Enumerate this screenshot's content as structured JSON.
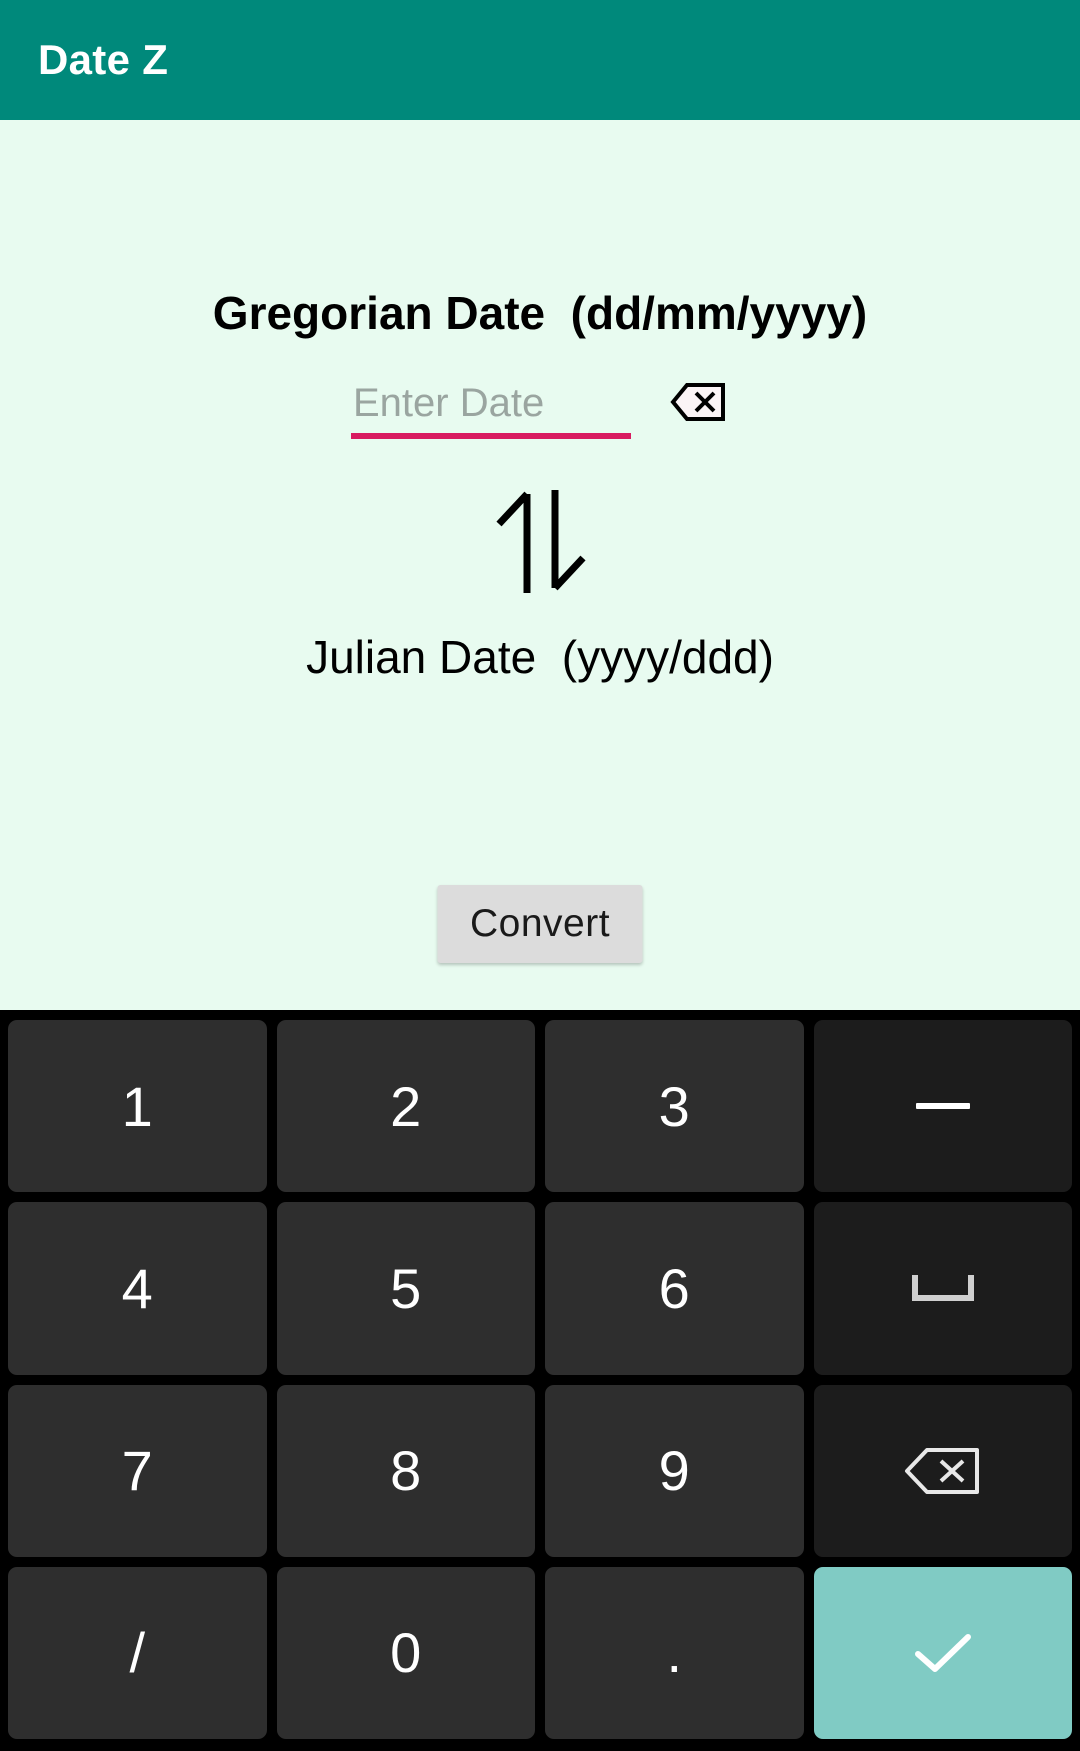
{
  "app": {
    "title": "Date Z",
    "appbar_color": "#00897b",
    "background_color": "#e8fbf0"
  },
  "form": {
    "gregorian_label": "Gregorian Date  (dd/mm/yyyy)",
    "julian_label": "Julian Date  (yyyy/ddd)",
    "date_input_value": "",
    "date_input_placeholder": "Enter Date",
    "underline_color": "#d81b60",
    "clear_icon": "backspace-icon",
    "swap_icon": "up-down-arrows-icon",
    "convert_label": "Convert"
  },
  "keyboard": {
    "rows": [
      [
        {
          "label": "1",
          "name": "key-1",
          "type": "digit"
        },
        {
          "label": "2",
          "name": "key-2",
          "type": "digit"
        },
        {
          "label": "3",
          "name": "key-3",
          "type": "digit"
        },
        {
          "label": "–",
          "name": "key-dash",
          "type": "fn-dash"
        }
      ],
      [
        {
          "label": "4",
          "name": "key-4",
          "type": "digit"
        },
        {
          "label": "5",
          "name": "key-5",
          "type": "digit"
        },
        {
          "label": "6",
          "name": "key-6",
          "type": "digit"
        },
        {
          "label": "",
          "name": "key-space",
          "type": "fn-space"
        }
      ],
      [
        {
          "label": "7",
          "name": "key-7",
          "type": "digit"
        },
        {
          "label": "8",
          "name": "key-8",
          "type": "digit"
        },
        {
          "label": "9",
          "name": "key-9",
          "type": "digit"
        },
        {
          "label": "",
          "name": "key-backspace",
          "type": "fn-backspace"
        }
      ],
      [
        {
          "label": "/",
          "name": "key-slash",
          "type": "digit"
        },
        {
          "label": "0",
          "name": "key-0",
          "type": "digit"
        },
        {
          "label": ".",
          "name": "key-period",
          "type": "digit"
        },
        {
          "label": "",
          "name": "key-enter",
          "type": "enter"
        }
      ]
    ],
    "enter_key_color": "#80cbc4",
    "digit_key_color": "#2e2e2e",
    "function_key_color": "#1c1c1c",
    "keyboard_background": "#000000"
  }
}
